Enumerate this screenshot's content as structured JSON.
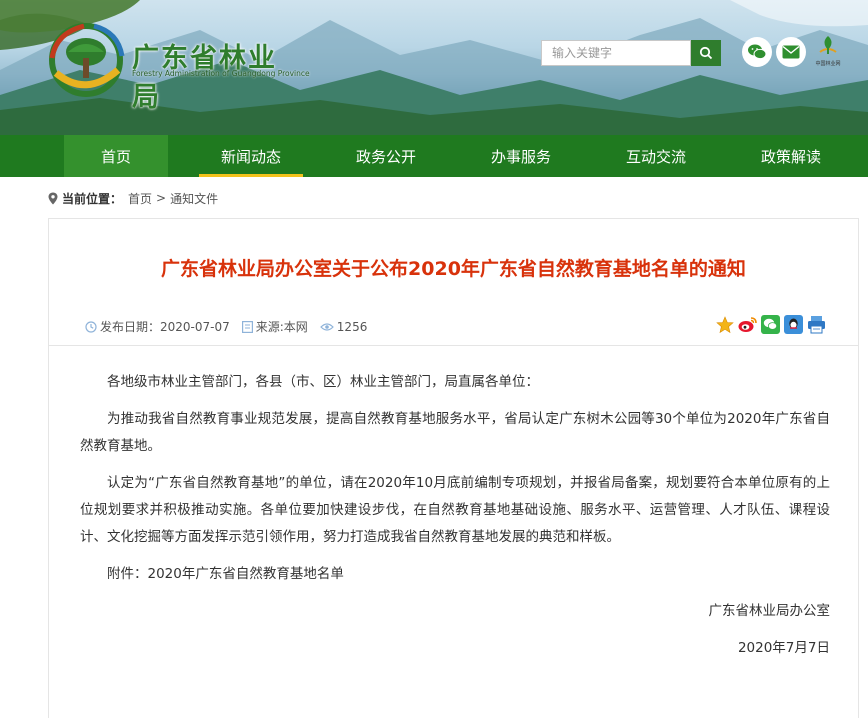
{
  "header": {
    "site_name": "广东省林业局",
    "site_name_en": "Forestry Administration of Guangdong Province",
    "search": {
      "placeholder": "输入关键字"
    },
    "forestry_link_label": "中国林业网"
  },
  "nav": {
    "items": [
      {
        "label": "首页",
        "active": true
      },
      {
        "label": "新闻动态"
      },
      {
        "label": "政务公开"
      },
      {
        "label": "办事服务"
      },
      {
        "label": "互动交流"
      },
      {
        "label": "政策解读"
      }
    ]
  },
  "breadcrumb": {
    "label": "当前位置：",
    "items": [
      "首页",
      "通知文件"
    ],
    "separator": ">"
  },
  "article": {
    "title": "广东省林业局办公室关于公布2020年广东省自然教育基地名单的通知",
    "publish_date": "发布日期：2020-07-07",
    "source": "来源:本网",
    "views": "1256",
    "paragraphs": [
      "各地级市林业主管部门，各县（市、区）林业主管部门，局直属各单位：",
      "为推动我省自然教育事业规范发展，提高自然教育基地服务水平，省局认定广东树木公园等30个单位为2020年广东省自然教育基地。",
      "认定为“广东省自然教育基地”的单位，请在2020年10月底前编制专项规划，并报省局备案，规划要符合本单位原有的上位规划要求并积极推动实施。各单位要加快建设步伐，在自然教育基地基础设施、服务水平、运营管理、人才队伍、课程设计、文化挖掘等方面发挥示范引领作用，努力打造成我省自然教育基地发展的典范和样板。",
      "附件：2020年广东省自然教育基地名单"
    ],
    "signature": "广东省林业局办公室",
    "sign_date": "2020年7月7日"
  },
  "colors": {
    "brand_green": "#1f7a1f",
    "nav_active": "#34912d",
    "underline_yellow": "#f2c21b",
    "title_red": "#d8320b"
  }
}
